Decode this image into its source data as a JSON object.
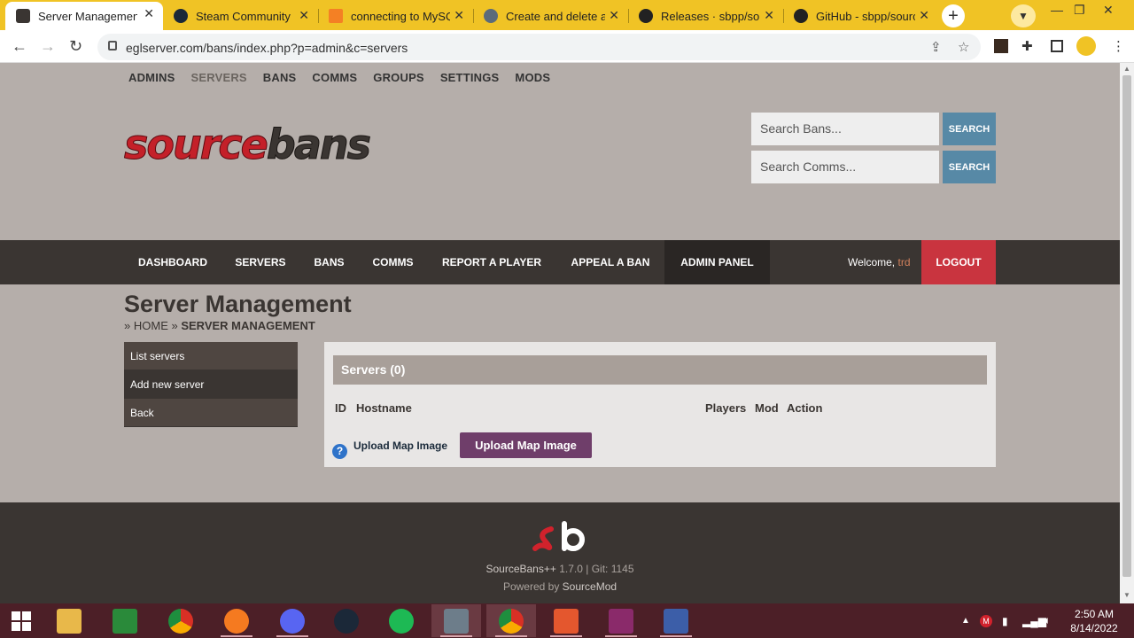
{
  "browser": {
    "tabs": [
      {
        "label": "Server Management",
        "active": true
      },
      {
        "label": "Steam Community"
      },
      {
        "label": "connecting to MySQ"
      },
      {
        "label": "Create and delete a f"
      },
      {
        "label": "Releases · sbpp/sour"
      },
      {
        "label": "GitHub - sbpp/sourc"
      }
    ],
    "url": "eglserver.com/bans/index.php?p=admin&c=servers"
  },
  "site": {
    "topnav": [
      "ADMINS",
      "SERVERS",
      "BANS",
      "COMMS",
      "GROUPS",
      "SETTINGS",
      "MODS"
    ],
    "logo_text": "sourcebans",
    "search_bans": {
      "placeholder": "Search Bans...",
      "button": "SEARCH"
    },
    "search_comms": {
      "placeholder": "Search Comms...",
      "button": "SEARCH"
    },
    "mainnav": [
      "DASHBOARD",
      "SERVERS",
      "BANS",
      "COMMS",
      "REPORT A PLAYER",
      "APPEAL A BAN",
      "ADMIN PANEL"
    ],
    "welcome_prefix": "Welcome,",
    "username": "trd",
    "logout": "LOGOUT"
  },
  "main": {
    "title": "Server Management",
    "breadcrumb": {
      "sep": "»",
      "home": "HOME",
      "current": "SERVER MANAGEMENT"
    },
    "sidemenu": [
      "List servers",
      "Add new server",
      "Back"
    ],
    "panel_title": "Servers (0)",
    "columns": [
      "ID",
      "Hostname",
      "Players",
      "Mod",
      "Action"
    ],
    "help_glyph": "?",
    "upload_label": "Upload Map Image",
    "upload_button": "Upload Map Image"
  },
  "footer": {
    "version": "SourceBans++",
    "version_num": "1.7.0 | Git: 1145",
    "powered_prefix": "Powered by",
    "powered_link": "SourceMod"
  },
  "taskbar": {
    "time": "2:50 AM",
    "date": "8/14/2022"
  },
  "colors": {
    "accent_yellow": "#f0c325",
    "nav_dark": "#3a3532",
    "logout_red": "#c9343f",
    "search_blue": "#5789a6",
    "upload_purple": "#6f3e6a"
  }
}
